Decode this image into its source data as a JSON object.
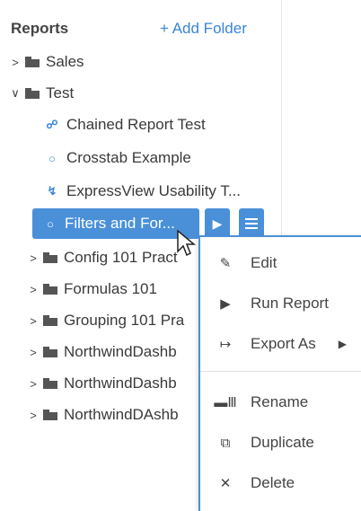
{
  "sidebar": {
    "title": "Reports",
    "add_folder": "+ Add Folder",
    "tree": [
      {
        "label": "Sales",
        "kind": "folder",
        "expanded": false
      },
      {
        "label": "Test",
        "kind": "folder",
        "expanded": true
      },
      {
        "label": "Chained Report Test",
        "kind": "chained-report",
        "icon": "link-icon"
      },
      {
        "label": "Crosstab Example",
        "kind": "report",
        "icon": "circle-icon"
      },
      {
        "label": "ExpressView Usability T...",
        "kind": "expressview",
        "icon": "bolt-icon"
      },
      {
        "label": "Filters and For...",
        "kind": "report",
        "icon": "circle-icon",
        "selected": true
      },
      {
        "label": "Config 101 Pract",
        "kind": "folder",
        "expanded": false
      },
      {
        "label": "Formulas 101",
        "kind": "folder",
        "expanded": false
      },
      {
        "label": "Grouping 101 Pra",
        "kind": "folder",
        "expanded": false
      },
      {
        "label": "NorthwindDashb",
        "kind": "folder",
        "expanded": false
      },
      {
        "label": "NorthwindDashb",
        "kind": "folder",
        "expanded": false
      },
      {
        "label": "NorthwindDAshb",
        "kind": "folder",
        "expanded": false
      }
    ]
  },
  "context_menu": {
    "items": [
      {
        "label": "Edit",
        "icon": "pencil-icon"
      },
      {
        "label": "Run Report",
        "icon": "play-icon"
      },
      {
        "label": "Export As",
        "icon": "export-icon",
        "has_submenu": true
      },
      {
        "label": "Rename",
        "icon": "rename-icon"
      },
      {
        "label": "Duplicate",
        "icon": "duplicate-icon"
      },
      {
        "label": "Delete",
        "icon": "delete-icon"
      }
    ]
  },
  "colors": {
    "accent": "#4a90d9",
    "link": "#3a86d6"
  }
}
